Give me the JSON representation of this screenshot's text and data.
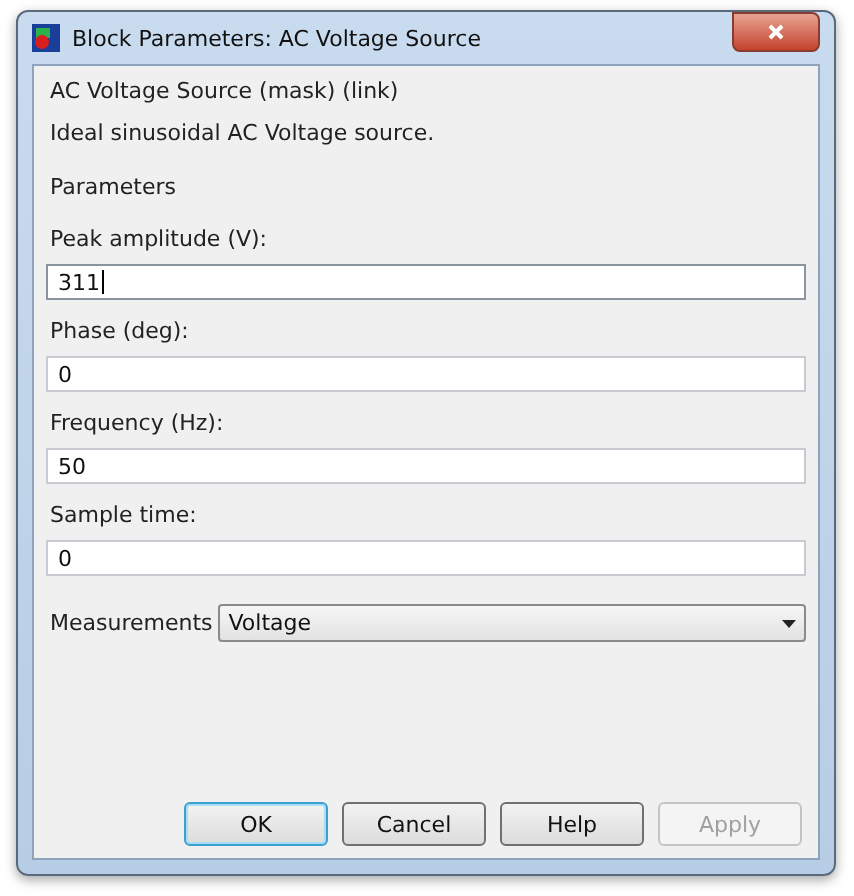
{
  "window": {
    "title": "Block Parameters: AC Voltage Source"
  },
  "header": "AC Voltage Source (mask) (link)",
  "description": "Ideal sinusoidal AC Voltage source.",
  "section": "Parameters",
  "fields": [
    {
      "label": "Peak amplitude (V):",
      "value": "311",
      "focused": true
    },
    {
      "label": "Phase (deg):",
      "value": "0",
      "focused": false
    },
    {
      "label": "Frequency (Hz):",
      "value": "50",
      "focused": false
    },
    {
      "label": "Sample time:",
      "value": "0",
      "focused": false
    }
  ],
  "dropdown": {
    "label": "Measurements",
    "value": "Voltage"
  },
  "buttons": [
    {
      "label": "OK",
      "default": true,
      "disabled": false
    },
    {
      "label": "Cancel",
      "default": false,
      "disabled": false
    },
    {
      "label": "Help",
      "default": false,
      "disabled": false
    },
    {
      "label": "Apply",
      "default": false,
      "disabled": true
    }
  ]
}
